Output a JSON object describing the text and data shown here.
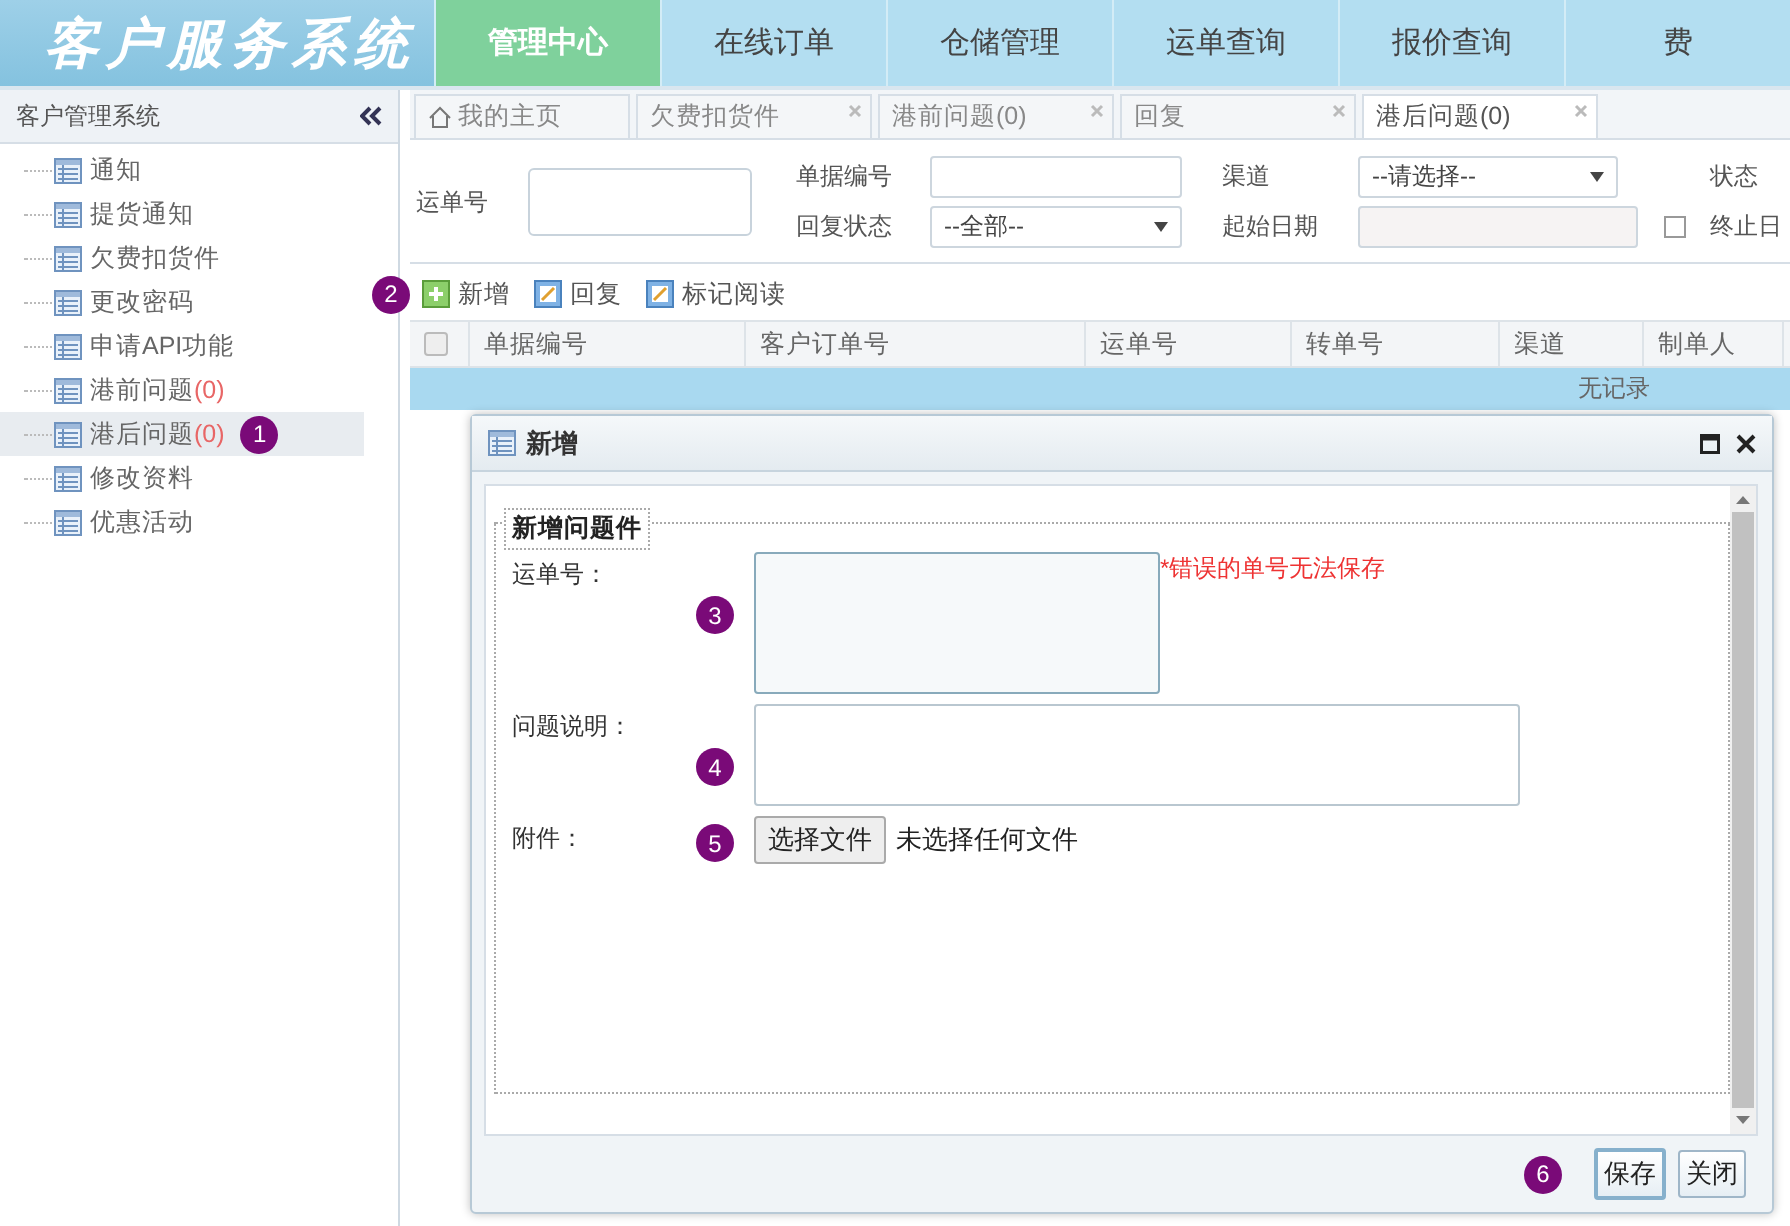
{
  "header": {
    "title": "客户服务系统",
    "nav": [
      {
        "label": "管理中心",
        "selected": true
      },
      {
        "label": "在线订单",
        "selected": false
      },
      {
        "label": "仓储管理",
        "selected": false
      },
      {
        "label": "运单查询",
        "selected": false
      },
      {
        "label": "报价查询",
        "selected": false
      },
      {
        "label": "费",
        "selected": false
      }
    ]
  },
  "sidebar": {
    "title": "客户管理系统",
    "items": [
      {
        "label": "通知",
        "selected": false
      },
      {
        "label": "提货通知",
        "selected": false
      },
      {
        "label": "欠费扣货件",
        "selected": false
      },
      {
        "label": "更改密码",
        "selected": false
      },
      {
        "label": "申请API功能",
        "selected": false
      },
      {
        "label": "港前问题",
        "count": "(0)",
        "selected": false
      },
      {
        "label": "港后问题",
        "count": "(0)",
        "selected": true,
        "marker": "1"
      },
      {
        "label": "修改资料",
        "selected": false
      },
      {
        "label": "优惠活动",
        "selected": false
      }
    ]
  },
  "tabs": [
    {
      "label": "我的主页",
      "kind": "home",
      "selected": false
    },
    {
      "label": "欠费扣货件",
      "kind": "closable",
      "selected": false
    },
    {
      "label": "港前问题(0)",
      "kind": "closable",
      "selected": false
    },
    {
      "label": "回复",
      "kind": "closable",
      "selected": false
    },
    {
      "label": "港后问题(0)",
      "kind": "closable",
      "selected": true
    }
  ],
  "filters": {
    "waybill_label": "运单号",
    "doc_no_label": "单据编号",
    "reply_status_label": "回复状态",
    "reply_status_value": "--全部--",
    "channel_label": "渠道",
    "channel_value": "--请选择--",
    "start_date_label": "起始日期",
    "status_label": "状态",
    "end_date_label": "终止日"
  },
  "toolbar": {
    "marker": "2",
    "buttons": [
      {
        "label": "新增",
        "kind": "add"
      },
      {
        "label": "回复",
        "kind": "edit"
      },
      {
        "label": "标记阅读",
        "kind": "edit"
      }
    ]
  },
  "table": {
    "select_all_checked": false,
    "columns": [
      "单据编号",
      "客户订单号",
      "运单号",
      "转单号",
      "渠道",
      "制单人"
    ],
    "empty_text": "无记录"
  },
  "dialog": {
    "title": "新增",
    "legend": "新增问题件",
    "fields": [
      {
        "label": "运单号：",
        "kind": "short_text",
        "marker": "3",
        "note": "*错误的单号无法保存"
      },
      {
        "label": "问题说明：",
        "kind": "long_text",
        "marker": "4"
      },
      {
        "label": "附件：",
        "kind": "file",
        "marker": "5",
        "button": "选择文件",
        "status": "未选择任何文件"
      }
    ],
    "footer_marker": "6",
    "buttons": [
      "保存",
      "关闭"
    ]
  }
}
